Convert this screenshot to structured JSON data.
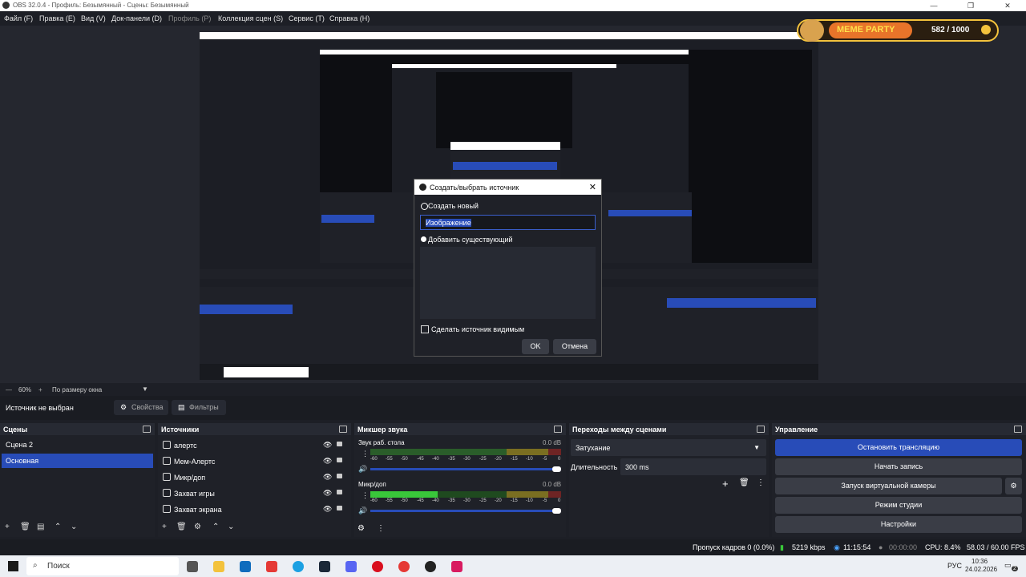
{
  "window": {
    "title": "OBS 32.0.4 - Профиль: Безымянный - Сцены: Безымянный",
    "minimize": "—",
    "maximize": "❐",
    "close": "✕"
  },
  "menu": [
    "Файл (F)",
    "Правка (E)",
    "Вид (V)",
    "Док-панели (D)",
    "Профиль (P)",
    "Коллекция сцен (S)",
    "Сервис (T)",
    "Справка (H)"
  ],
  "overlay": {
    "brand": "MEME PARTY",
    "score": "582 / 1000"
  },
  "dialog": {
    "title": "Создать/выбрать источник",
    "create_new": "Создать новый",
    "name_value": "Изображение",
    "add_existing": "Добавить существующий",
    "make_visible": "Сделать источник видимым",
    "ok": "OK",
    "cancel": "Отмена"
  },
  "viewbar": {
    "zoom": "60%",
    "fit": "По размеру окна"
  },
  "source_bar": {
    "status": "Источник не выбран",
    "properties": "Свойства",
    "filters": "Фильтры"
  },
  "scenes": {
    "title": "Сцены",
    "items": [
      "Сцена 2",
      "Основная"
    ],
    "selected": 1
  },
  "sources": {
    "title": "Источники",
    "items": [
      "алертс",
      "Мем-Алертс",
      "Микр/доп",
      "Захват игры",
      "Захват экрана"
    ]
  },
  "mixer": {
    "title": "Микшер звука",
    "channels": [
      {
        "name": "Звук раб. стола",
        "db": "0.0 dB"
      },
      {
        "name": "Микр/доп",
        "db": "0.0 dB"
      }
    ],
    "ticks": [
      "-60",
      "-55",
      "-50",
      "-45",
      "-40",
      "-35",
      "-30",
      "-25",
      "-20",
      "-15",
      "-10",
      "-5",
      "0"
    ]
  },
  "transitions": {
    "title": "Переходы между сценами",
    "type": "Затухание",
    "duration_label": "Длительность",
    "duration_value": "300 ms"
  },
  "controls": {
    "title": "Управление",
    "stop_stream": "Остановить трансляцию",
    "start_record": "Начать запись",
    "virtual_cam": "Запуск виртуальной камеры",
    "studio_mode": "Режим студии",
    "settings": "Настройки"
  },
  "status": {
    "dropped": "Пропуск кадров 0 (0.0%)",
    "bitrate": "5219 kbps",
    "stream_time": "11:15:54",
    "rec_time": "00:00:00",
    "cpu": "CPU: 8.4%",
    "fps": "58.03 / 60.00 FPS"
  },
  "taskbar": {
    "search": "Поиск",
    "lang": "РУС",
    "time": "10:36",
    "date": "24.02.2026",
    "notif": "2"
  },
  "colors": {
    "accent": "#284cb8",
    "bg": "#1d1f26",
    "dock": "#1f2128"
  }
}
